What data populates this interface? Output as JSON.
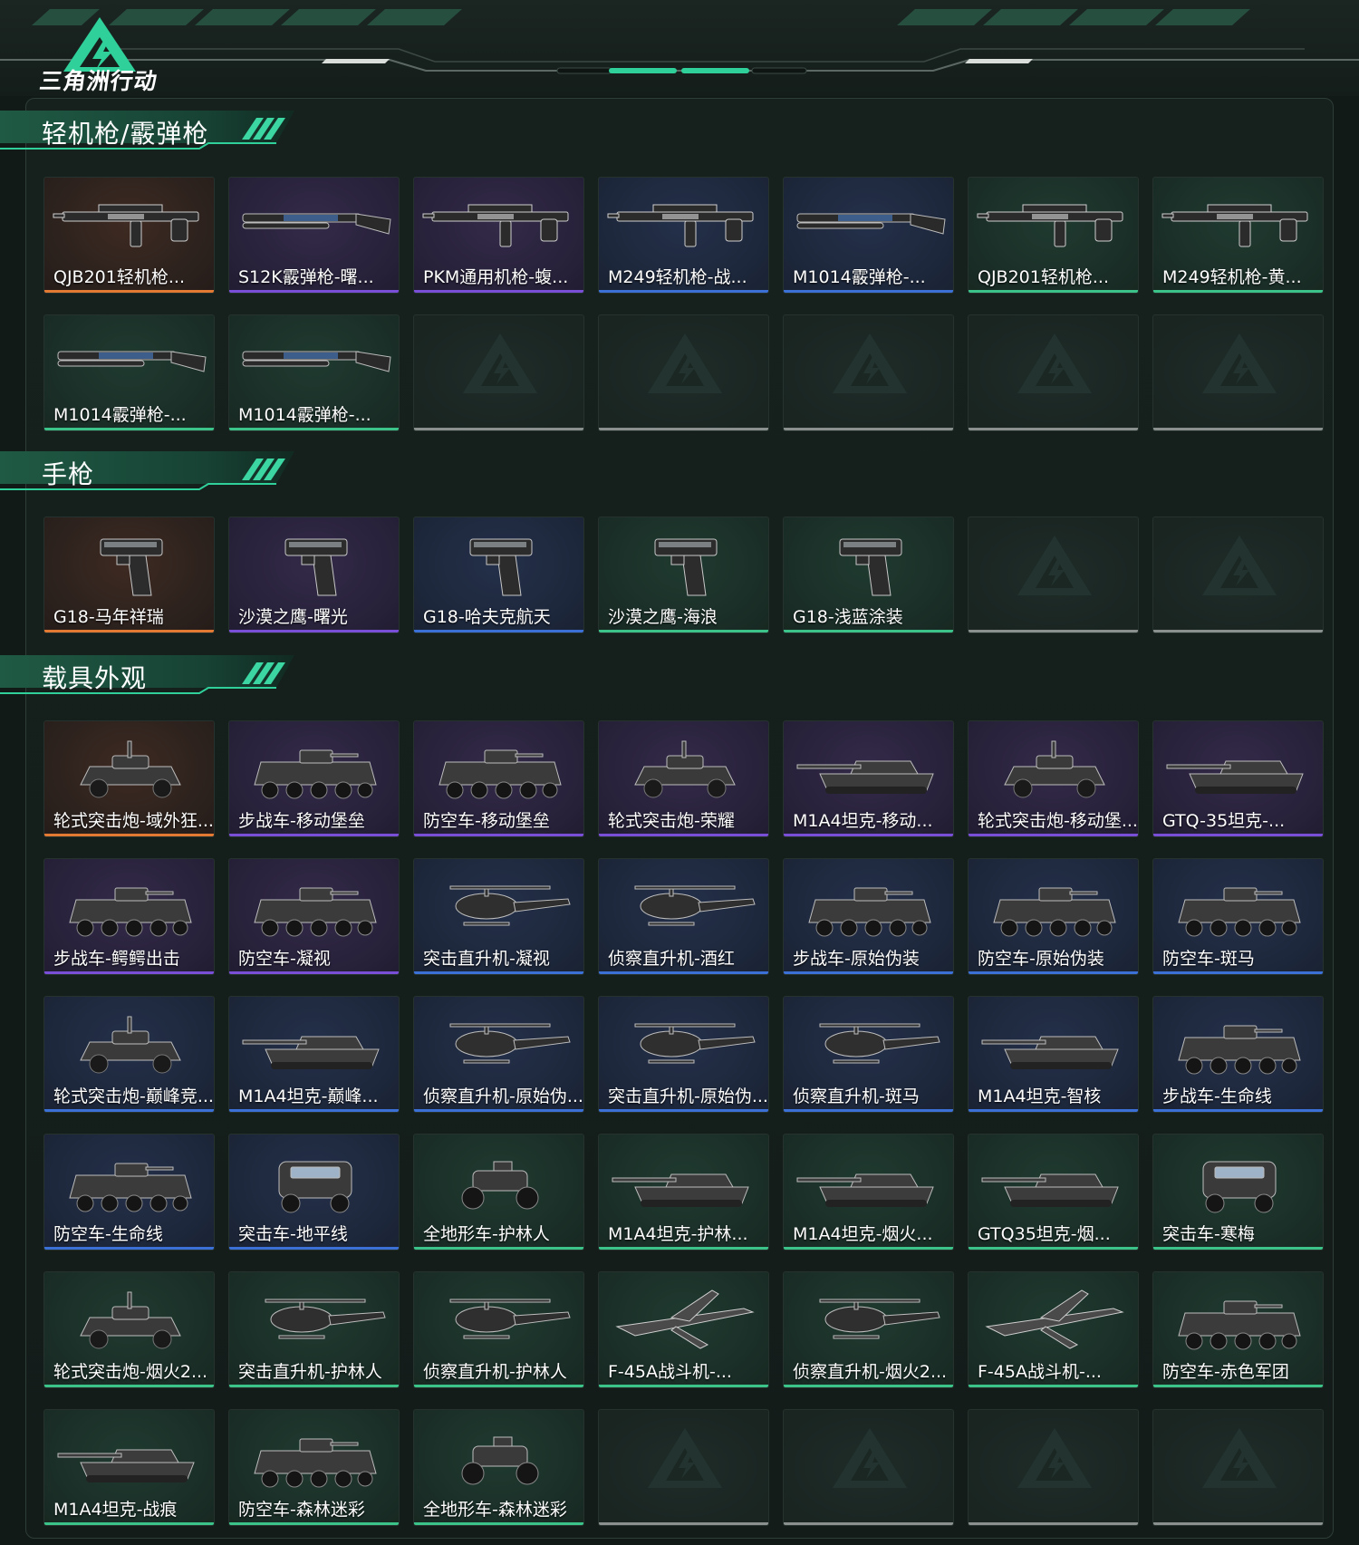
{
  "app": {
    "logo_text": "三角洲行动",
    "logo_icon": "delta-force-triangle-logo"
  },
  "colors": {
    "accent": "#2fd09a",
    "rarity_orange": "#e27a34",
    "rarity_purple": "#7a4fd8",
    "rarity_blue": "#3b71d6",
    "rarity_green": "#3cc38a"
  },
  "sections": [
    {
      "title": "轻机枪/霰弹枪",
      "items": [
        {
          "label": "QJB201轻机枪...",
          "rarity": "orange",
          "kind": "lmg"
        },
        {
          "label": "S12K霰弹枪-曙...",
          "rarity": "purple",
          "kind": "shotgun"
        },
        {
          "label": "PKM通用机枪-蝮...",
          "rarity": "purple",
          "kind": "lmg"
        },
        {
          "label": "M249轻机枪-战...",
          "rarity": "blue",
          "kind": "lmg"
        },
        {
          "label": "M1014霰弹枪-...",
          "rarity": "blue",
          "kind": "shotgun"
        },
        {
          "label": "QJB201轻机枪...",
          "rarity": "green",
          "kind": "lmg"
        },
        {
          "label": "M249轻机枪-黄...",
          "rarity": "green",
          "kind": "lmg"
        },
        {
          "label": "M1014霰弹枪-...",
          "rarity": "green",
          "kind": "shotgun"
        },
        {
          "label": "M1014霰弹枪-...",
          "rarity": "green",
          "kind": "shotgun"
        },
        {
          "label": "",
          "rarity": "empty"
        },
        {
          "label": "",
          "rarity": "empty"
        },
        {
          "label": "",
          "rarity": "empty"
        },
        {
          "label": "",
          "rarity": "empty"
        },
        {
          "label": "",
          "rarity": "empty"
        }
      ]
    },
    {
      "title": "手枪",
      "items": [
        {
          "label": "G18-马年祥瑞",
          "rarity": "orange",
          "kind": "pistol"
        },
        {
          "label": "沙漠之鹰-曙光",
          "rarity": "purple",
          "kind": "pistol"
        },
        {
          "label": "G18-哈夫克航天",
          "rarity": "blue",
          "kind": "pistol"
        },
        {
          "label": "沙漠之鹰-海浪",
          "rarity": "green",
          "kind": "pistol"
        },
        {
          "label": "G18-浅蓝涂装",
          "rarity": "green",
          "kind": "pistol"
        },
        {
          "label": "",
          "rarity": "empty"
        },
        {
          "label": "",
          "rarity": "empty"
        }
      ]
    },
    {
      "title": "载具外观",
      "items": [
        {
          "label": "轮式突击炮-域外狂...",
          "rarity": "orange",
          "kind": "wheeled"
        },
        {
          "label": "步战车-移动堡垒",
          "rarity": "purple",
          "kind": "ifv"
        },
        {
          "label": "防空车-移动堡垒",
          "rarity": "purple",
          "kind": "ifv"
        },
        {
          "label": "轮式突击炮-荣耀",
          "rarity": "purple",
          "kind": "wheeled"
        },
        {
          "label": "M1A4坦克-移动...",
          "rarity": "purple",
          "kind": "tank"
        },
        {
          "label": "轮式突击炮-移动堡...",
          "rarity": "purple",
          "kind": "wheeled"
        },
        {
          "label": "GTQ-35坦克-...",
          "rarity": "purple",
          "kind": "tank"
        },
        {
          "label": "步战车-鳄鳄出击",
          "rarity": "purple",
          "kind": "ifv"
        },
        {
          "label": "防空车-凝视",
          "rarity": "purple",
          "kind": "ifv"
        },
        {
          "label": "突击直升机-凝视",
          "rarity": "blue",
          "kind": "heli"
        },
        {
          "label": "侦察直升机-酒红",
          "rarity": "blue",
          "kind": "heli"
        },
        {
          "label": "步战车-原始伪装",
          "rarity": "blue",
          "kind": "ifv"
        },
        {
          "label": "防空车-原始伪装",
          "rarity": "blue",
          "kind": "ifv"
        },
        {
          "label": "防空车-斑马",
          "rarity": "blue",
          "kind": "ifv"
        },
        {
          "label": "轮式突击炮-巅峰竞...",
          "rarity": "blue",
          "kind": "wheeled"
        },
        {
          "label": "M1A4坦克-巅峰...",
          "rarity": "blue",
          "kind": "tank"
        },
        {
          "label": "侦察直升机-原始伪...",
          "rarity": "blue",
          "kind": "heli"
        },
        {
          "label": "突击直升机-原始伪...",
          "rarity": "blue",
          "kind": "heli"
        },
        {
          "label": "侦察直升机-斑马",
          "rarity": "blue",
          "kind": "heli"
        },
        {
          "label": "M1A4坦克-智核",
          "rarity": "blue",
          "kind": "tank"
        },
        {
          "label": "步战车-生命线",
          "rarity": "blue",
          "kind": "ifv"
        },
        {
          "label": "防空车-生命线",
          "rarity": "blue",
          "kind": "ifv"
        },
        {
          "label": "突击车-地平线",
          "rarity": "blue",
          "kind": "truck"
        },
        {
          "label": "全地形车-护林人",
          "rarity": "green",
          "kind": "atv"
        },
        {
          "label": "M1A4坦克-护林...",
          "rarity": "green",
          "kind": "tank"
        },
        {
          "label": "M1A4坦克-烟火...",
          "rarity": "green",
          "kind": "tank"
        },
        {
          "label": "GTQ35坦克-烟...",
          "rarity": "green",
          "kind": "tank"
        },
        {
          "label": "突击车-寒梅",
          "rarity": "green",
          "kind": "truck"
        },
        {
          "label": "轮式突击炮-烟火2...",
          "rarity": "green",
          "kind": "wheeled"
        },
        {
          "label": "突击直升机-护林人",
          "rarity": "green",
          "kind": "heli"
        },
        {
          "label": "侦察直升机-护林人",
          "rarity": "green",
          "kind": "heli"
        },
        {
          "label": "F-45A战斗机-...",
          "rarity": "green",
          "kind": "jet"
        },
        {
          "label": "侦察直升机-烟火2...",
          "rarity": "green",
          "kind": "heli"
        },
        {
          "label": "F-45A战斗机-...",
          "rarity": "green",
          "kind": "jet"
        },
        {
          "label": "防空车-赤色军团",
          "rarity": "green",
          "kind": "ifv"
        },
        {
          "label": "M1A4坦克-战痕",
          "rarity": "green",
          "kind": "tank"
        },
        {
          "label": "防空车-森林迷彩",
          "rarity": "green",
          "kind": "ifv"
        },
        {
          "label": "全地形车-森林迷彩",
          "rarity": "green",
          "kind": "atv"
        },
        {
          "label": "",
          "rarity": "empty"
        },
        {
          "label": "",
          "rarity": "empty"
        },
        {
          "label": "",
          "rarity": "empty"
        },
        {
          "label": "",
          "rarity": "empty"
        }
      ]
    }
  ]
}
